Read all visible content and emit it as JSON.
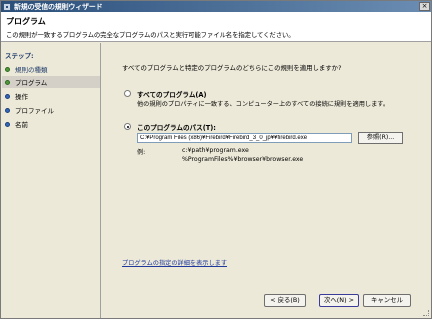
{
  "window": {
    "title": "新規の受信の規則ウィザード",
    "close_glyph": "×"
  },
  "header": {
    "title": "プログラム",
    "description": "この規則が一致するプログラムの完全なプログラムのパスと実行可能ファイル名を指定してください。"
  },
  "sidebar": {
    "heading": "ステップ:",
    "items": [
      {
        "label": "規則の種類",
        "status": "done"
      },
      {
        "label": "プログラム",
        "status": "current"
      },
      {
        "label": "操作",
        "status": "todo"
      },
      {
        "label": "プロファイル",
        "status": "todo"
      },
      {
        "label": "名前",
        "status": "todo"
      }
    ]
  },
  "main": {
    "question": "すべてのプログラムと特定のプログラムのどちらにこの規則を適用しますか?",
    "option_all": {
      "label": "すべてのプログラム(A)",
      "description": "他の規則のプロパティに一致する、コンピューター上のすべての接続に規則を適用します。",
      "selected": false
    },
    "option_path": {
      "label": "このプログラムのパス(T):",
      "selected": true,
      "value": "C:¥Program Files (x86)¥Firebird¥Firebird_3_0_jp¥¥firebird.exe"
    },
    "browse_label": "参照(R)...",
    "example_label": "例:",
    "example_line1": "c:¥path¥program.exe",
    "example_line2": "%ProgramFiles%¥browser¥browser.exe",
    "help_link": "プログラムの指定の詳細を表示します"
  },
  "footer": {
    "back_label": "< 戻る(B)",
    "next_label": "次へ(N) >",
    "cancel_label": "キャンセル"
  },
  "colors": {
    "title_bar_start": "#2a4f7a",
    "title_bar_end": "#6b8db3",
    "link": "#1f3a9b",
    "step_done": "#4f9a3b",
    "step_todo": "#3467b8"
  }
}
